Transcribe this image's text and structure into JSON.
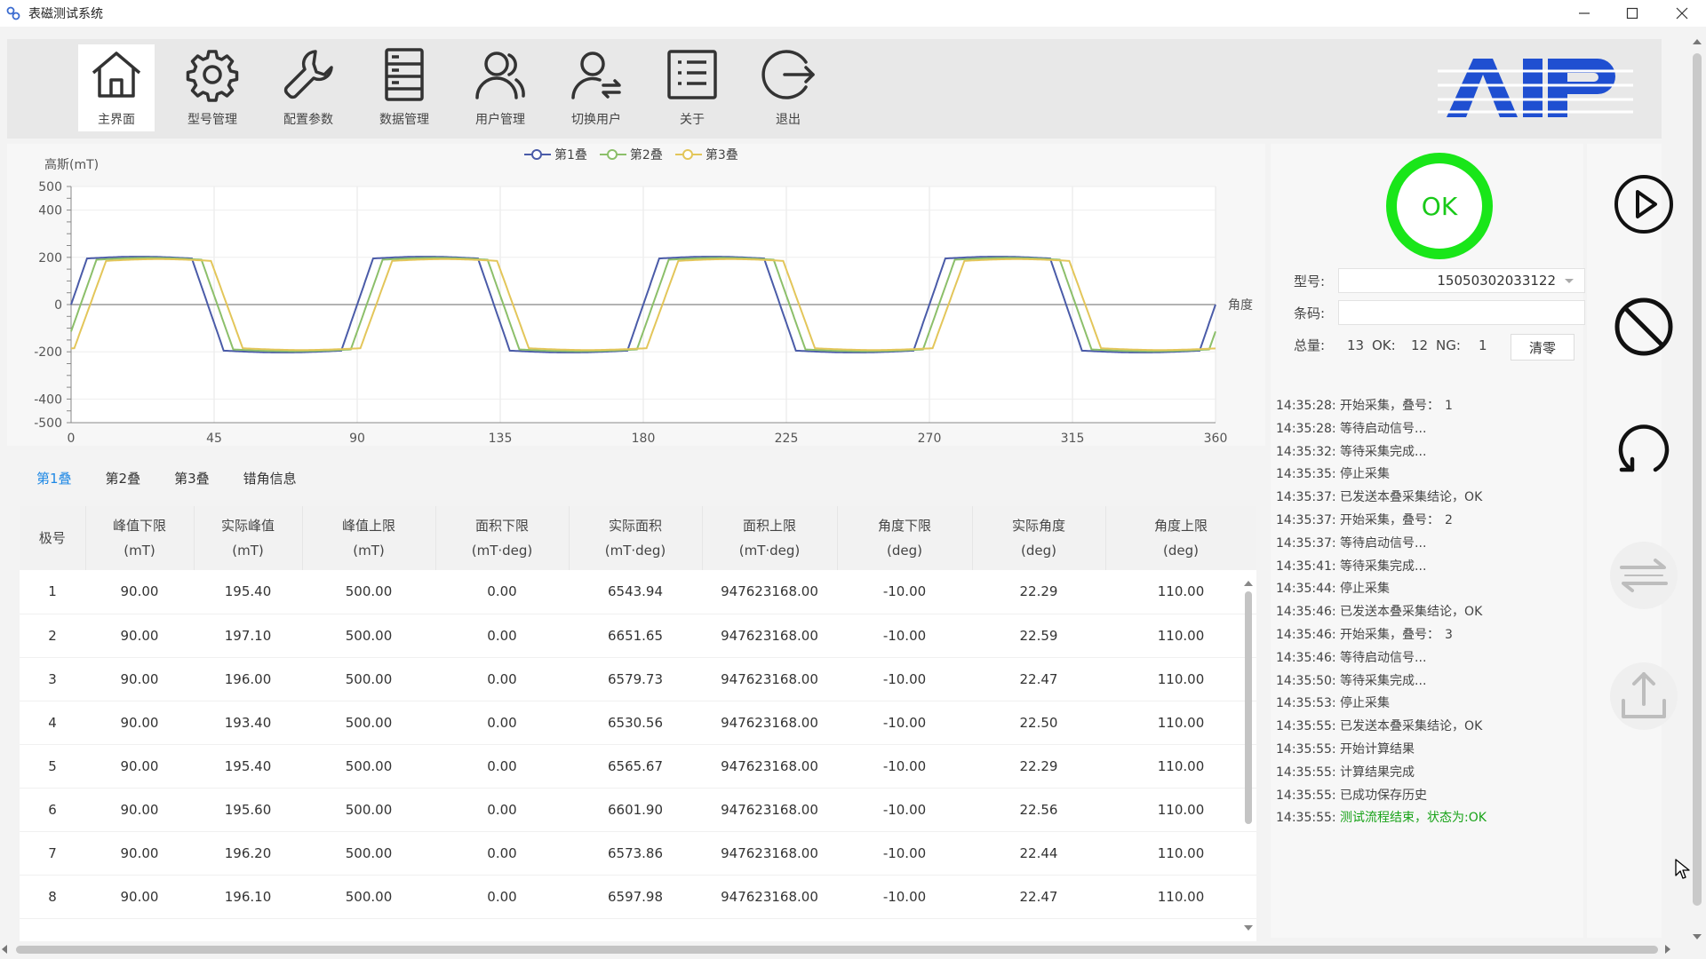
{
  "window": {
    "title": "表磁测试系统"
  },
  "toolbar": {
    "items": [
      {
        "label": "主界面",
        "icon": "home-icon",
        "active": true
      },
      {
        "label": "型号管理",
        "icon": "gear-icon"
      },
      {
        "label": "配置参数",
        "icon": "wrench-icon"
      },
      {
        "label": "数据管理",
        "icon": "database-icon"
      },
      {
        "label": "用户管理",
        "icon": "users-icon"
      },
      {
        "label": "切换用户",
        "icon": "switch-user-icon"
      },
      {
        "label": "关于",
        "icon": "list-icon"
      },
      {
        "label": "退出",
        "icon": "exit-icon"
      }
    ],
    "brand_logo": "AIP",
    "brand_color": "#1f4fd1"
  },
  "chart_data": {
    "type": "line",
    "ylabel": "高斯(mT)",
    "xlabel": "角度",
    "xlim": [
      0,
      360
    ],
    "ylim": [
      -500,
      500
    ],
    "x_ticks": [
      0,
      45,
      90,
      135,
      180,
      225,
      270,
      315,
      360
    ],
    "y_ticks": [
      500,
      400,
      200,
      0,
      -200,
      -400,
      -500
    ],
    "grid": true,
    "legend_position": "top-center",
    "waveform": "trapezoidal, period 90 deg, amplitude approx 190 mT",
    "series": [
      {
        "name": "第1叠",
        "color": "#4a5ba8",
        "phase_offset_deg": 0,
        "amplitude": 195
      },
      {
        "name": "第2叠",
        "color": "#8cbf6a",
        "phase_offset_deg": 3,
        "amplitude": 190
      },
      {
        "name": "第3叠",
        "color": "#e3c65a",
        "phase_offset_deg": 6,
        "amplitude": 185
      }
    ]
  },
  "tabs": [
    {
      "label": "第1叠",
      "active": true
    },
    {
      "label": "第2叠"
    },
    {
      "label": "第3叠"
    },
    {
      "label": "错角信息"
    }
  ],
  "table": {
    "headers": [
      [
        "极号",
        ""
      ],
      [
        "峰值下限",
        "(mT)"
      ],
      [
        "实际峰值",
        "(mT)"
      ],
      [
        "峰值上限",
        "(mT)"
      ],
      [
        "面积下限",
        "(mT·deg)"
      ],
      [
        "实际面积",
        "(mT·deg)"
      ],
      [
        "面积上限",
        "(mT·deg)"
      ],
      [
        "角度下限",
        "(deg)"
      ],
      [
        "实际角度",
        "(deg)"
      ],
      [
        "角度上限",
        "(deg)"
      ]
    ],
    "rows": [
      [
        "1",
        "90.00",
        "195.40",
        "500.00",
        "0.00",
        "6543.94",
        "947623168.00",
        "-10.00",
        "22.29",
        "110.00"
      ],
      [
        "2",
        "90.00",
        "197.10",
        "500.00",
        "0.00",
        "6651.65",
        "947623168.00",
        "-10.00",
        "22.59",
        "110.00"
      ],
      [
        "3",
        "90.00",
        "196.00",
        "500.00",
        "0.00",
        "6579.73",
        "947623168.00",
        "-10.00",
        "22.47",
        "110.00"
      ],
      [
        "4",
        "90.00",
        "193.40",
        "500.00",
        "0.00",
        "6530.56",
        "947623168.00",
        "-10.00",
        "22.50",
        "110.00"
      ],
      [
        "5",
        "90.00",
        "195.40",
        "500.00",
        "0.00",
        "6565.67",
        "947623168.00",
        "-10.00",
        "22.29",
        "110.00"
      ],
      [
        "6",
        "90.00",
        "195.60",
        "500.00",
        "0.00",
        "6601.90",
        "947623168.00",
        "-10.00",
        "22.56",
        "110.00"
      ],
      [
        "7",
        "90.00",
        "196.20",
        "500.00",
        "0.00",
        "6573.86",
        "947623168.00",
        "-10.00",
        "22.44",
        "110.00"
      ],
      [
        "8",
        "90.00",
        "196.10",
        "500.00",
        "0.00",
        "6597.98",
        "947623168.00",
        "-10.00",
        "22.47",
        "110.00"
      ]
    ]
  },
  "status": {
    "result": "OK",
    "result_color": "#19e619"
  },
  "form": {
    "model_label": "型号:",
    "model_value": "15050302033122",
    "barcode_label": "条码:",
    "barcode_value": ""
  },
  "counts": {
    "total_label": "总量:",
    "total": "13",
    "ok_label": "OK:",
    "ok": "12",
    "ng_label": "NG:",
    "ng": "1",
    "clear_label": "清零"
  },
  "log": [
    {
      "time": "14:35:28:",
      "text": "开始采集，叠号：",
      "value": "1"
    },
    {
      "time": "14:35:28:",
      "text": "等待启动信号..."
    },
    {
      "time": "14:35:32:",
      "text": "等待采集完成..."
    },
    {
      "time": "14:35:35:",
      "text": "停止采集"
    },
    {
      "time": "14:35:37:",
      "text": "已发送本叠采集结论，OK"
    },
    {
      "time": "14:35:37:",
      "text": "开始采集，叠号：",
      "value": "2"
    },
    {
      "time": "14:35:37:",
      "text": "等待启动信号..."
    },
    {
      "time": "14:35:41:",
      "text": "等待采集完成..."
    },
    {
      "time": "14:35:44:",
      "text": "停止采集"
    },
    {
      "time": "14:35:46:",
      "text": "已发送本叠采集结论，OK"
    },
    {
      "time": "14:35:46:",
      "text": "开始采集，叠号：",
      "value": "3"
    },
    {
      "time": "14:35:46:",
      "text": "等待启动信号..."
    },
    {
      "time": "14:35:50:",
      "text": "等待采集完成..."
    },
    {
      "time": "14:35:53:",
      "text": "停止采集"
    },
    {
      "time": "14:35:55:",
      "text": "已发送本叠采集结论，OK"
    },
    {
      "time": "14:35:55:",
      "text": "开始计算结果"
    },
    {
      "time": "14:35:55:",
      "text": "计算结果完成"
    },
    {
      "time": "14:35:55:",
      "text": "已成功保存历史"
    },
    {
      "time": "14:35:55:",
      "text": "测试流程结束，状态为:OK",
      "highlight": true
    }
  ],
  "side_buttons": [
    {
      "icon": "play-icon",
      "enabled": true
    },
    {
      "icon": "stop-icon",
      "enabled": true
    },
    {
      "icon": "reset-icon",
      "enabled": true
    },
    {
      "icon": "switch-icon",
      "enabled": false
    },
    {
      "icon": "upload-icon",
      "enabled": false
    }
  ]
}
